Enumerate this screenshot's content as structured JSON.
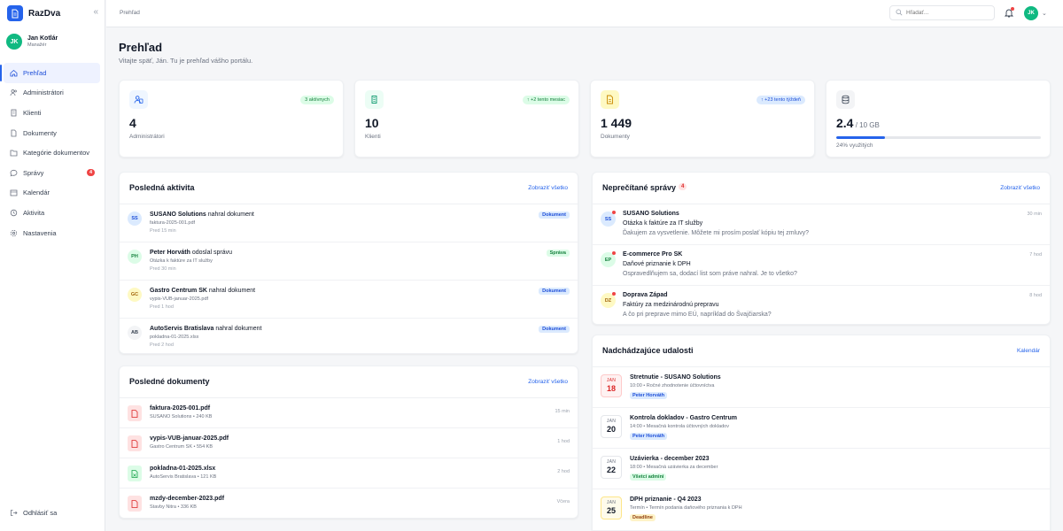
{
  "app": {
    "name": "RazDva"
  },
  "user": {
    "initials": "JK",
    "name": "Jan Kotlár",
    "role": "Manažér"
  },
  "nav": [
    {
      "label": "Prehľad",
      "icon": "home-icon",
      "active": true
    },
    {
      "label": "Administrátori",
      "icon": "users-icon"
    },
    {
      "label": "Klienti",
      "icon": "building-icon"
    },
    {
      "label": "Dokumenty",
      "icon": "document-icon"
    },
    {
      "label": "Kategórie dokumentov",
      "icon": "folder-icon"
    },
    {
      "label": "Správy",
      "icon": "message-icon",
      "badge": "4"
    },
    {
      "label": "Kalendár",
      "icon": "calendar-icon"
    },
    {
      "label": "Aktivita",
      "icon": "clock-icon"
    },
    {
      "label": "Nastavenia",
      "icon": "gear-icon"
    }
  ],
  "logout": "Odhlásiť sa",
  "topbar": {
    "breadcrumb": "Prehľad",
    "search_placeholder": "Hľadať...",
    "avatar": "JK"
  },
  "header": {
    "title": "Prehľad",
    "subtitle": "Vitajte späť, Ján. Tu je prehľad vášho portálu."
  },
  "stats": [
    {
      "value": "4",
      "label": "Administrátori",
      "tag": "3 aktívnych",
      "icon": "users-icon"
    },
    {
      "value": "10",
      "label": "Klienti",
      "tag": "↑ +2 tento mesiac",
      "icon": "building-icon"
    },
    {
      "value": "1 449",
      "label": "Dokumenty",
      "tag": "↑ +23 tento týždeň",
      "icon": "document-icon"
    },
    {
      "value": "2.4",
      "value_suffix": " / 10 GB",
      "label": "24% využitých",
      "progress": 0.24,
      "icon": "database-icon"
    }
  ],
  "activity": {
    "title": "Posledná aktivita",
    "link": "Zobraziť všetko",
    "items": [
      {
        "initials": "SS",
        "actor": "SUSANO Solutions",
        "action": " nahral dokument",
        "detail": "faktura-2025-001.pdf",
        "time": "Pred 15 min",
        "tag": "Dokument"
      },
      {
        "initials": "PH",
        "actor": "Peter Horváth",
        "action": " odoslal správu",
        "detail": "Otázka k faktúre za IT služby",
        "time": "Pred 30 min",
        "tag": "Správa"
      },
      {
        "initials": "GC",
        "actor": "Gastro Centrum SK",
        "action": " nahral dokument",
        "detail": "vypis-VUB-januar-2025.pdf",
        "time": "Pred 1 hod",
        "tag": "Dokument"
      },
      {
        "initials": "AB",
        "actor": "AutoServis Bratislava",
        "action": " nahral dokument",
        "detail": "pokladna-01-2025.xlsx",
        "time": "Pred 2 hod",
        "tag": "Dokument"
      }
    ]
  },
  "documents": {
    "title": "Posledné dokumenty",
    "link": "Zobraziť všetko",
    "items": [
      {
        "name": "faktura-2025-001.pdf",
        "meta": "SUSANO Solutions • 240 KB",
        "time": "15 min",
        "type": "pdf"
      },
      {
        "name": "vypis-VUB-januar-2025.pdf",
        "meta": "Gastro Centrum SK • 554 KB",
        "time": "1 hod",
        "type": "pdf"
      },
      {
        "name": "pokladna-01-2025.xlsx",
        "meta": "AutoServis Bratislava • 121 KB",
        "time": "2 hod",
        "type": "xlsx"
      },
      {
        "name": "mzdy-december-2023.pdf",
        "meta": "Stavby Nitra • 336 KB",
        "time": "Včera",
        "type": "pdf"
      }
    ]
  },
  "messages": {
    "title": "Neprečítané správy",
    "count": "4",
    "link": "Zobraziť všetko",
    "items": [
      {
        "initials": "SS",
        "from": "SUSANO Solutions",
        "subject": "Otázka k faktúre za IT služby",
        "preview": "Ďakujem za vysvetlenie. Môžete mi prosím poslať kópiu tej zmluvy?",
        "time": "30 min"
      },
      {
        "initials": "EP",
        "from": "E-commerce Pro SK",
        "subject": "Daňové priznanie k DPH",
        "preview": "Ospravedlňujem sa, dodací list som práve nahral. Je to všetko?",
        "time": "7 hod"
      },
      {
        "initials": "DZ",
        "from": "Doprava Západ",
        "subject": "Faktúry za medzinárodnú prepravu",
        "preview": "A čo pri preprave mimo EÚ, napríklad do Švajčiarska?",
        "time": "8 hod"
      }
    ]
  },
  "events": {
    "title": "Nadchádzajúce udalosti",
    "link": "Kalendár",
    "items": [
      {
        "month": "JAN",
        "day": "18",
        "title": "Stretnutie - SUSANO Solutions",
        "detail": "10:00 • Ročné zhodnotenie účtovníctva",
        "tag": "Peter Horváth",
        "style": "hl"
      },
      {
        "month": "JAN",
        "day": "20",
        "title": "Kontrola dokladov - Gastro Centrum",
        "detail": "14:00 • Mesačná kontrola účtovných dokladov",
        "tag": "Peter Horváth",
        "style": ""
      },
      {
        "month": "JAN",
        "day": "22",
        "title": "Uzávierka - december 2023",
        "detail": "18:00 • Mesačná uzávierka za december",
        "tag": "Všetci admini",
        "style": ""
      },
      {
        "month": "JAN",
        "day": "25",
        "title": "DPH priznanie - Q4 2023",
        "detail": "Termín • Termín podania daňového priznania k DPH",
        "tag": "Deadline",
        "style": "warn"
      }
    ]
  },
  "colors": {
    "accent": "#2563eb",
    "success": "#10b981",
    "danger": "#ef4444",
    "warning": "#f59e0b"
  }
}
